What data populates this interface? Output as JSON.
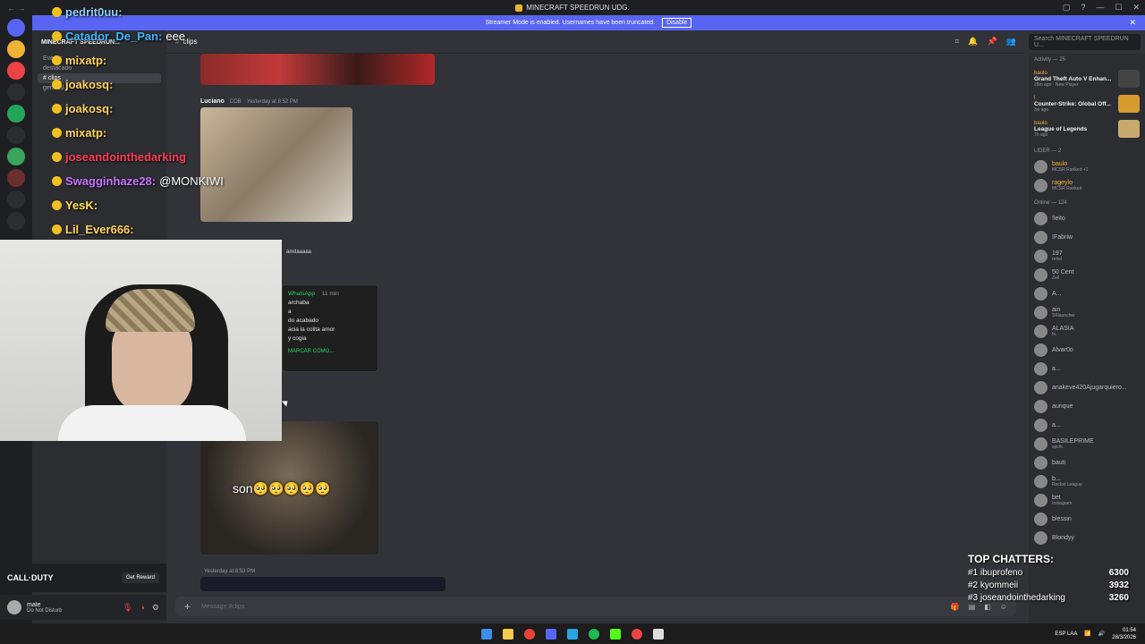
{
  "window": {
    "title": "MINECRAFT SPEEDRUN UDG.",
    "streamer_banner": "Streamer Mode is enabled. Usernames have been truncated.",
    "banner_button": "Disable"
  },
  "server": {
    "name": "MINECRAFT SPEEDRUN...",
    "channels": [
      "Events",
      "destacado",
      "clips",
      "general 1"
    ],
    "active_channel": "clips"
  },
  "channel_header": {
    "name": "clips",
    "search_placeholder": "Search MINECRAFT SPEEDRUN U..."
  },
  "messages": {
    "m1_author": "Luciano",
    "m1_tag": "COB",
    "m1_time": "Yesterday at 8:52 PM",
    "m2_time": "Yesterday at 8:53 PM",
    "m2_snippet": "amitaaaaa",
    "wa_app": "WhatsApp",
    "wa_time": "11 min",
    "wa_lines": [
      "archaba",
      "a",
      "do acabado",
      "acia la colita amor",
      "y cogia"
    ],
    "wa_action": "MARCAR COMO...",
    "meme_text": "son🥺🥺🥺🥺🥺",
    "m4_time": "Yesterday at 8:53 PM"
  },
  "composer": {
    "placeholder": "Message #clips"
  },
  "user": {
    "name": "mate",
    "status": "Do Not Disturb"
  },
  "promo": {
    "game": "CALL·DUTY",
    "reward_button": "Get Reward"
  },
  "members": {
    "activity_header": "Activity — 25",
    "activities": [
      {
        "who": "baulo",
        "game": "Grand Theft Auto V Enhan...",
        "time": "29m ago · New Player"
      },
      {
        "who": "l",
        "game": "Counter-Strike: Global Off...",
        "time": "3w ago"
      },
      {
        "who": "baulo",
        "game": "League of Legends",
        "time": "7h ago"
      }
    ],
    "lider_header": "LIDER — 2",
    "lider": [
      {
        "name": "baulo",
        "status": "MCSR Ranked +1",
        "color": "#f0b232"
      },
      {
        "name": "rageylo",
        "status": "MCSR Ranked",
        "color": "#f0b232"
      }
    ],
    "online_header": "Online — 124",
    "online": [
      {
        "name": "!leito",
        "status": ""
      },
      {
        "name": "!Fabriw",
        "status": ""
      },
      {
        "name": "197",
        "status": "rehel"
      },
      {
        "name": "50 Cent",
        "status": "Zell"
      },
      {
        "name": "A...",
        "status": ""
      },
      {
        "name": "ain",
        "status": "SKlauncher"
      },
      {
        "name": "ALASIA",
        "status": "fo."
      },
      {
        "name": "Alvar0o",
        "status": ""
      },
      {
        "name": "a...",
        "status": ""
      },
      {
        "name": "anakeve420Ajugarquiero...",
        "status": ""
      },
      {
        "name": "aunque",
        "status": ""
      },
      {
        "name": "a...",
        "status": ""
      },
      {
        "name": "BASILEPRIME",
        "status": "spchi"
      },
      {
        "name": "bauti",
        "status": ""
      },
      {
        "name": "b...",
        "status": "Rocket League"
      },
      {
        "name": "bet",
        "status": "Instagram"
      },
      {
        "name": "blessin",
        "status": ""
      },
      {
        "name": "Blondyy",
        "status": ""
      }
    ]
  },
  "overlay_chat": [
    {
      "user": "pedrit0uu:",
      "color": "#8fd0ff",
      "msg": ""
    },
    {
      "user": "Catador_De_Pan:",
      "color": "#3db5ff",
      "msg": "eee"
    },
    {
      "user": "mixatp:",
      "color": "#ffd35c",
      "msg": ""
    },
    {
      "user": "joakosq:",
      "color": "#ffd35c",
      "msg": ""
    },
    {
      "user": "joakosq:",
      "color": "#ffd35c",
      "msg": ""
    },
    {
      "user": "mixatp:",
      "color": "#ffd35c",
      "msg": ""
    },
    {
      "user": "joseandointhedarking",
      "color": "#ff3b55",
      "msg": ""
    },
    {
      "user": "Swagginhaze28:",
      "color": "#c873ff",
      "msg": "@MONKIWI"
    },
    {
      "user": "YesK:",
      "color": "#ffe14f",
      "msg": ""
    },
    {
      "user": "Lil_Ever666:",
      "color": "#ffd35c",
      "msg": ""
    }
  ],
  "top_chatters": {
    "title": "TOP CHATTERS:",
    "rows": [
      {
        "rank": "#1 ibuprofeno",
        "score": "6300"
      },
      {
        "rank": "#2 kyommeii",
        "score": "3932"
      },
      {
        "rank": "#3 joseandointhedarking",
        "score": "3260"
      }
    ]
  },
  "taskbar": {
    "lang": "ESP LAA",
    "time": "01:54",
    "date": "28/3/2026"
  },
  "colors": {
    "accent": "#5865f2",
    "bg": "#313338",
    "sidebar": "#2b2d31"
  }
}
